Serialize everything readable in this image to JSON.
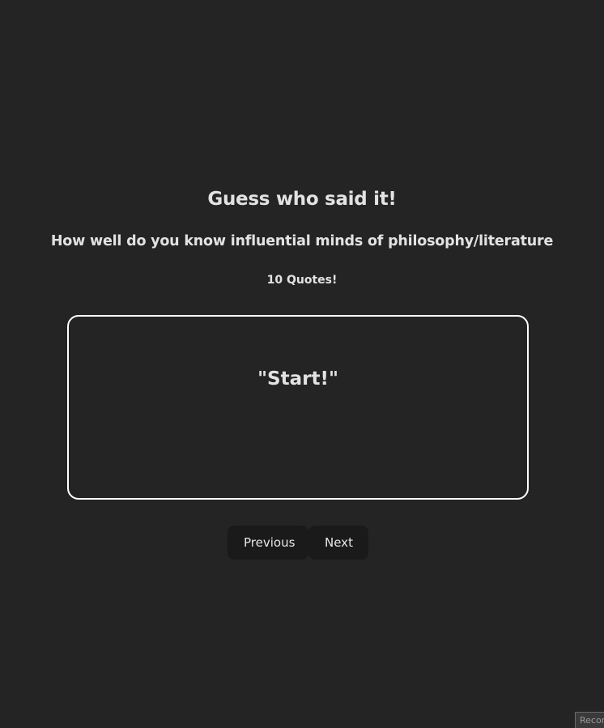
{
  "header": {
    "title": "Guess who said it!",
    "subtitle": "How well do you know influential minds of philosophy/literature",
    "count": "10 Quotes!"
  },
  "card": {
    "quote": "\"Start!\""
  },
  "nav": {
    "previous_label": "Previous",
    "next_label": "Next"
  },
  "corner": {
    "label": "Recor"
  },
  "colors": {
    "background": "#242424",
    "button_bg": "#1a1a1a",
    "card_border": "#ffffff"
  }
}
